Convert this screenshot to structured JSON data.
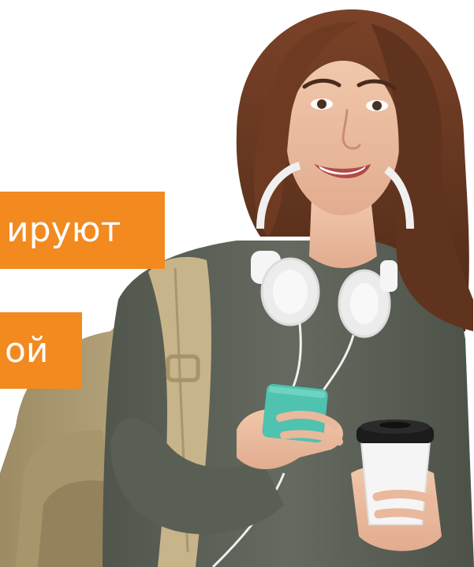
{
  "banners": [
    {
      "text": "ируют"
    },
    {
      "text": "ой"
    }
  ],
  "colors": {
    "banner_background": "#f28a1f",
    "banner_text": "#ffffff",
    "background": "#ffffff",
    "sweater": "#5e6359",
    "hair": "#6b3a22",
    "backpack": "#b9a57c",
    "phone": "#4fc2b0",
    "headphones": "#f2f2f2",
    "cup": "#f5f5f5",
    "cup_lid": "#1c1c1c"
  }
}
